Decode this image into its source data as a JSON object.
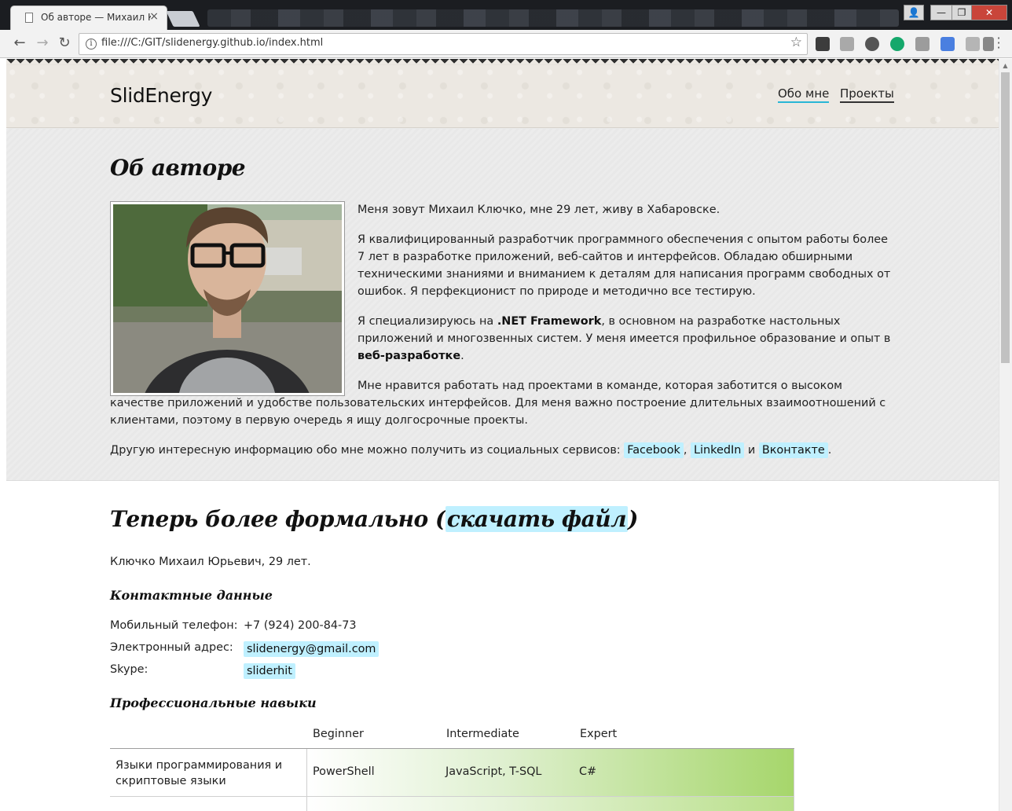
{
  "browser": {
    "tab_title": "Об авторе — Михаил Ключко",
    "tab_close": "×",
    "url": "file:///C:/GIT/slidenergy.github.io/index.html",
    "window_controls": {
      "profile": "👤",
      "minimize": "—",
      "restore": "❐",
      "close": "✕"
    },
    "icons": {
      "back": "back-arrow-icon",
      "forward": "forward-arrow-icon",
      "reload": "reload-icon",
      "info": "info-icon",
      "star": "bookmark-star-icon",
      "menu": "menu-dots-icon"
    },
    "extensions": [
      "evernote-icon",
      "dropbox-icon",
      "sync-icon",
      "grammarly-icon",
      "u-icon",
      "translate-icon",
      "pdf-icon",
      "mail-icon"
    ]
  },
  "header": {
    "brand": "SlidEnergy",
    "nav": [
      {
        "label": "Обо мне",
        "active": true
      },
      {
        "label": "Проекты",
        "active": false
      }
    ]
  },
  "about": {
    "title": "Об авторе",
    "p1": "Меня зовут Михаил Ключко, мне 29 лет, живу в Хабаровске.",
    "p2": "Я квалифицированный разработчик программного обеспечения с опытом работы более 7 лет в разработке приложений, веб-сайтов и интерфейсов. Обладаю обширными техническими знаниями и вниманием к деталям для написания программ свободных от ошибок. Я перфекционист по природе и методично все тестирую.",
    "p3_before": "Я специализируюсь на ",
    "p3_bold1": ".NET Framework",
    "p3_middle": ", в основном на разработке настольных приложений и многозвенных систем. У меня имеется профильное образование и опыт в ",
    "p3_bold2": "веб-разработке",
    "p3_after": ".",
    "p4": "Мне нравится работать над проектами в команде, которая заботится о высоком качестве приложений и удобстве пользовательских интерфейсов. Для меня важно построение длительных взаимоотношений с клиентами, поэтому в первую очередь я ищу долгосрочные проекты.",
    "social_before": "Другую интересную информацию обо мне можно получить из социальных сервисов: ",
    "social": [
      "Facebook",
      "LinkedIn",
      "Вконтакте"
    ],
    "social_sep1": ", ",
    "social_sep2": " и ",
    "social_end": "."
  },
  "formal": {
    "title": "Теперь более формально",
    "title_paren_open": " (",
    "download": "скачать файл",
    "title_paren_close": ")",
    "fio": "Ключко Михаил Юрьевич, 29 лет.",
    "contacts_title": "Контактные данные",
    "contacts": [
      {
        "label": "Мобильный телефон:",
        "value": "+7 (924) 200-84-73"
      },
      {
        "label": "Электронный адрес:",
        "value": "slidenergy@gmail.com"
      },
      {
        "label": "Skype:",
        "value": "sliderhit"
      }
    ],
    "skills_title": "Профессиональные навыки",
    "skills_levels": [
      "Beginner",
      "Intermediate",
      "Expert"
    ],
    "skills_rows": [
      {
        "category": "Языки программирования и скриптовые языки",
        "beginner": "PowerShell",
        "intermediate": "JavaScript, T-SQL",
        "expert": "C#"
      }
    ]
  },
  "colors": {
    "link_bg": "#bff0ff",
    "nav_active": "#29b6d6",
    "skills_green": "#a6d66b"
  }
}
